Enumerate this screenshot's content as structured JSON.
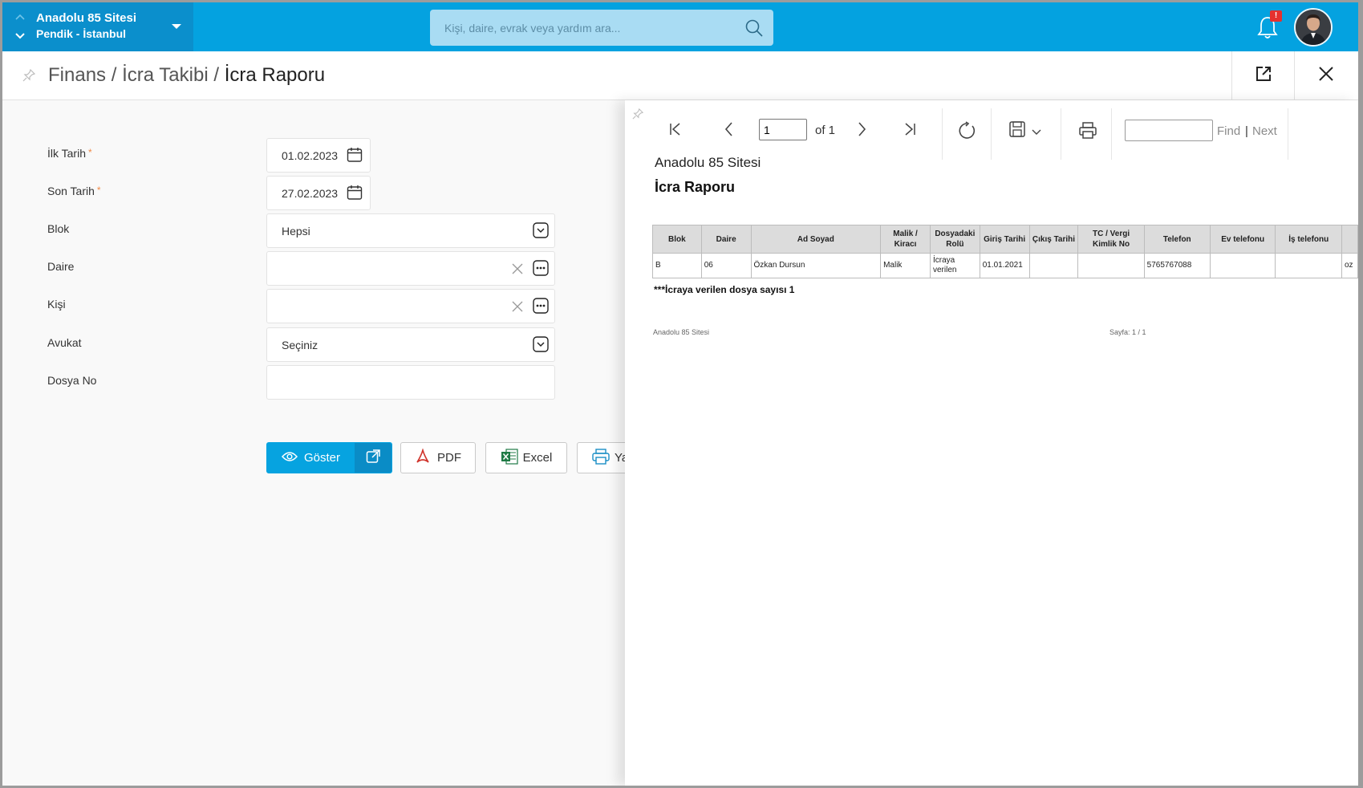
{
  "topbar": {
    "site_name": "Anadolu 85 Sitesi",
    "site_location": "Pendik - İstanbul",
    "search_placeholder": "Kişi, daire, evrak veya yardım ara...",
    "notification_badge": "!",
    "brand_color": "#04a2e0"
  },
  "breadcrumb": {
    "part1": "Finans",
    "sep": " / ",
    "part2": "İcra Takibi",
    "current": "İcra Raporu"
  },
  "form": {
    "ilk_tarih": {
      "label": "İlk Tarih",
      "required": "*",
      "value": "01.02.2023"
    },
    "son_tarih": {
      "label": "Son Tarih",
      "required": "*",
      "value": "27.02.2023"
    },
    "blok": {
      "label": "Blok",
      "value": "Hepsi"
    },
    "daire": {
      "label": "Daire",
      "value": ""
    },
    "kisi": {
      "label": "Kişi",
      "value": ""
    },
    "avukat": {
      "label": "Avukat",
      "value": "Seçiniz"
    },
    "dosya_no": {
      "label": "Dosya No",
      "value": ""
    }
  },
  "actions": {
    "goster": "Göster",
    "pdf": "PDF",
    "excel": "Excel",
    "yazdir_partial": "Ya"
  },
  "viewer": {
    "page_value": "1",
    "of_label": "of 1",
    "find": "Find",
    "find_sep": "|",
    "next": "Next"
  },
  "report": {
    "site": "Anadolu 85 Sitesi",
    "title": "İcra Raporu",
    "columns": [
      "Blok",
      "Daire",
      "Ad Soyad",
      "Malik / Kiracı",
      "Dosyadaki Rolü",
      "Giriş Tarihi",
      "Çıkış Tarihi",
      "TC / Vergi Kimlik No",
      "Telefon",
      "Ev telefonu",
      "İş telefonu",
      ""
    ],
    "rows": [
      [
        "B",
        "06",
        "Özkan Dursun",
        "Malik",
        "İcraya verilen",
        "01.01.2021",
        "",
        "",
        "5765767088",
        "",
        "",
        "oz"
      ]
    ],
    "note": "***İcraya verilen dosya sayısı 1",
    "footer_left": "Anadolu 85 Sitesi",
    "footer_right": "Sayfa: 1 / 1"
  }
}
